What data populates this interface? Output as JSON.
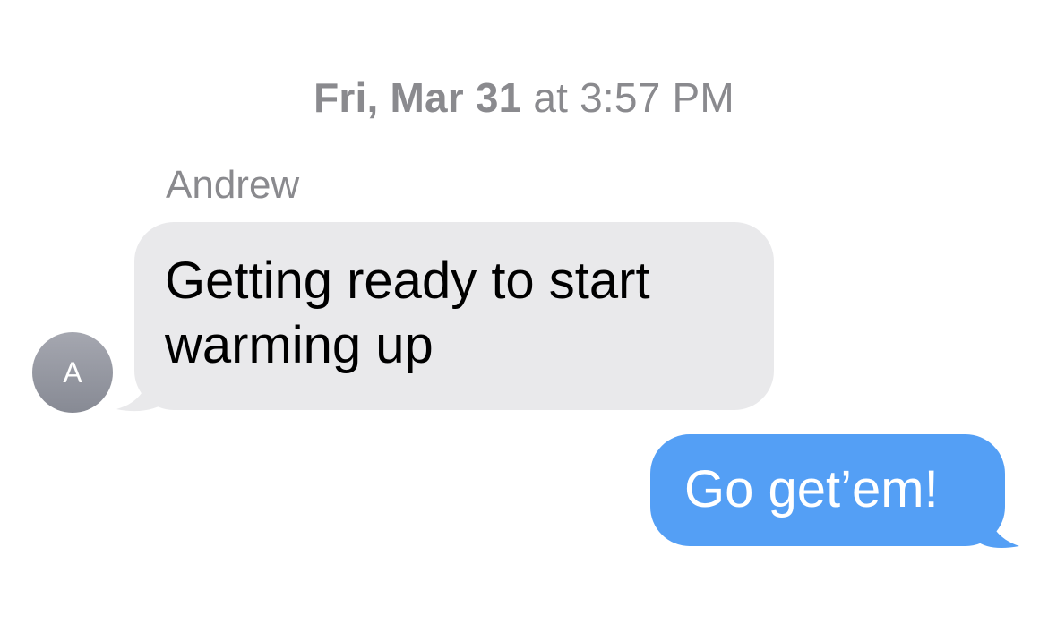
{
  "timestamp": {
    "date": "Fri, Mar 31",
    "time": " at 3:57 PM"
  },
  "conversation": {
    "messages": [
      {
        "direction": "incoming",
        "sender": "Andrew",
        "avatar_initial": "A",
        "text": "Getting ready to start warming up",
        "bubble_color": "#e9e9eb"
      },
      {
        "direction": "outgoing",
        "text": "Go get’em!",
        "bubble_color": "#549ff5"
      }
    ]
  }
}
